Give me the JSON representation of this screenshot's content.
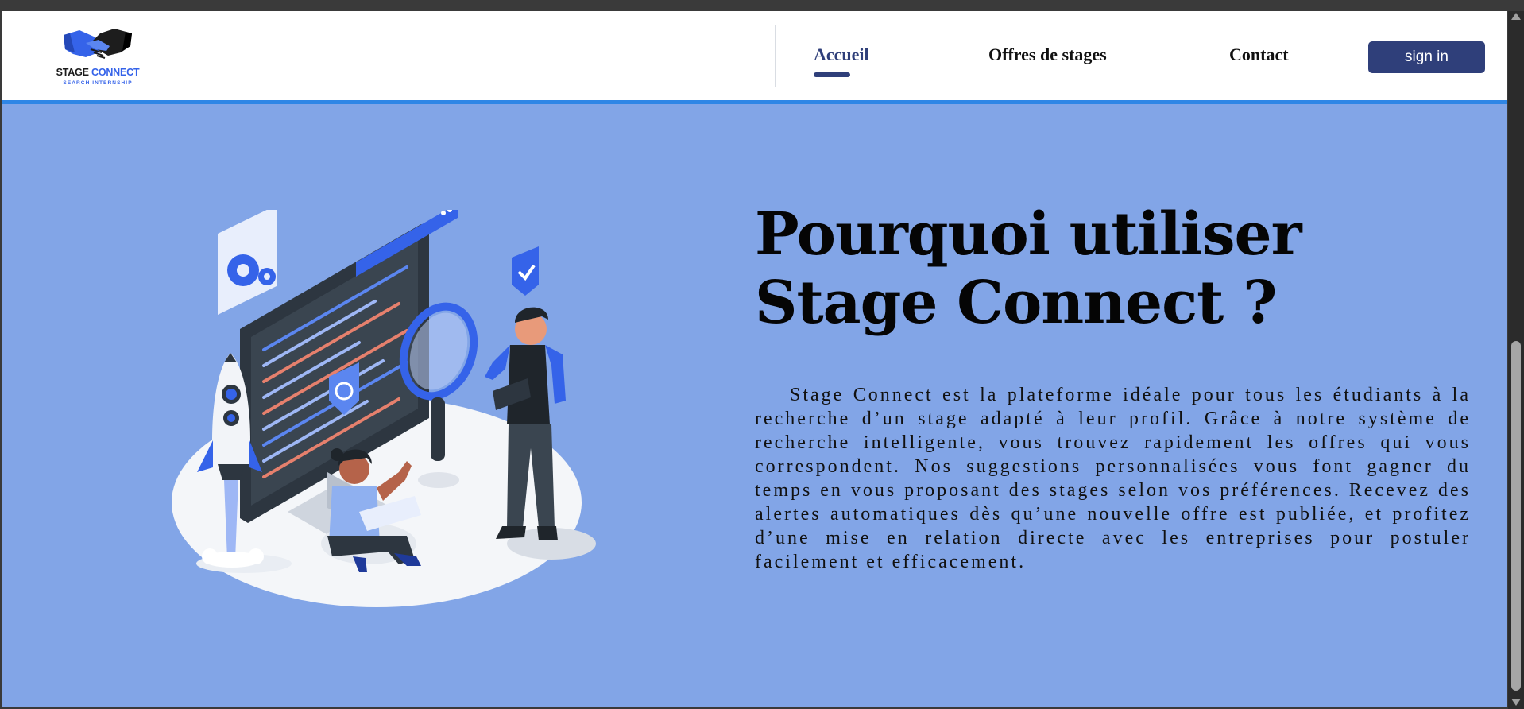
{
  "brand": {
    "name_part1": "STAGE ",
    "name_part2": "CONNECT",
    "tagline": "SEARCH INTERNSHIP",
    "logo_icon": "handshake-icon"
  },
  "nav": {
    "items": [
      {
        "label": "Accueil",
        "active": true
      },
      {
        "label": "Offres de stages",
        "active": false
      },
      {
        "label": "Contact",
        "active": false
      }
    ],
    "signin_label": "sign in"
  },
  "hero": {
    "title": "Pourquoi utiliser Stage Connect ?",
    "text": "Stage Connect est la plateforme idéale pour tous les étudiants à la recherche d’un stage adapté à leur profil. Grâce à notre système de recherche intelligente, vous trouvez rapidement les offres qui vous correspondent. Nos suggestions personnalisées vous font gagner du temps en vous proposant des stages selon vos préférences. Recevez des alertes automatiques dès qu’une nouvelle offre est publiée, et profitez d’une mise en relation directe avec les entreprises pour postuler facilement et efficacement.",
    "illustration": "developer-team-illustration"
  },
  "colors": {
    "hero_background": "#82a5e7",
    "accent_dark": "#2f3f7a",
    "brand_blue": "#3563e9",
    "nav_border": "#2f86e6"
  }
}
